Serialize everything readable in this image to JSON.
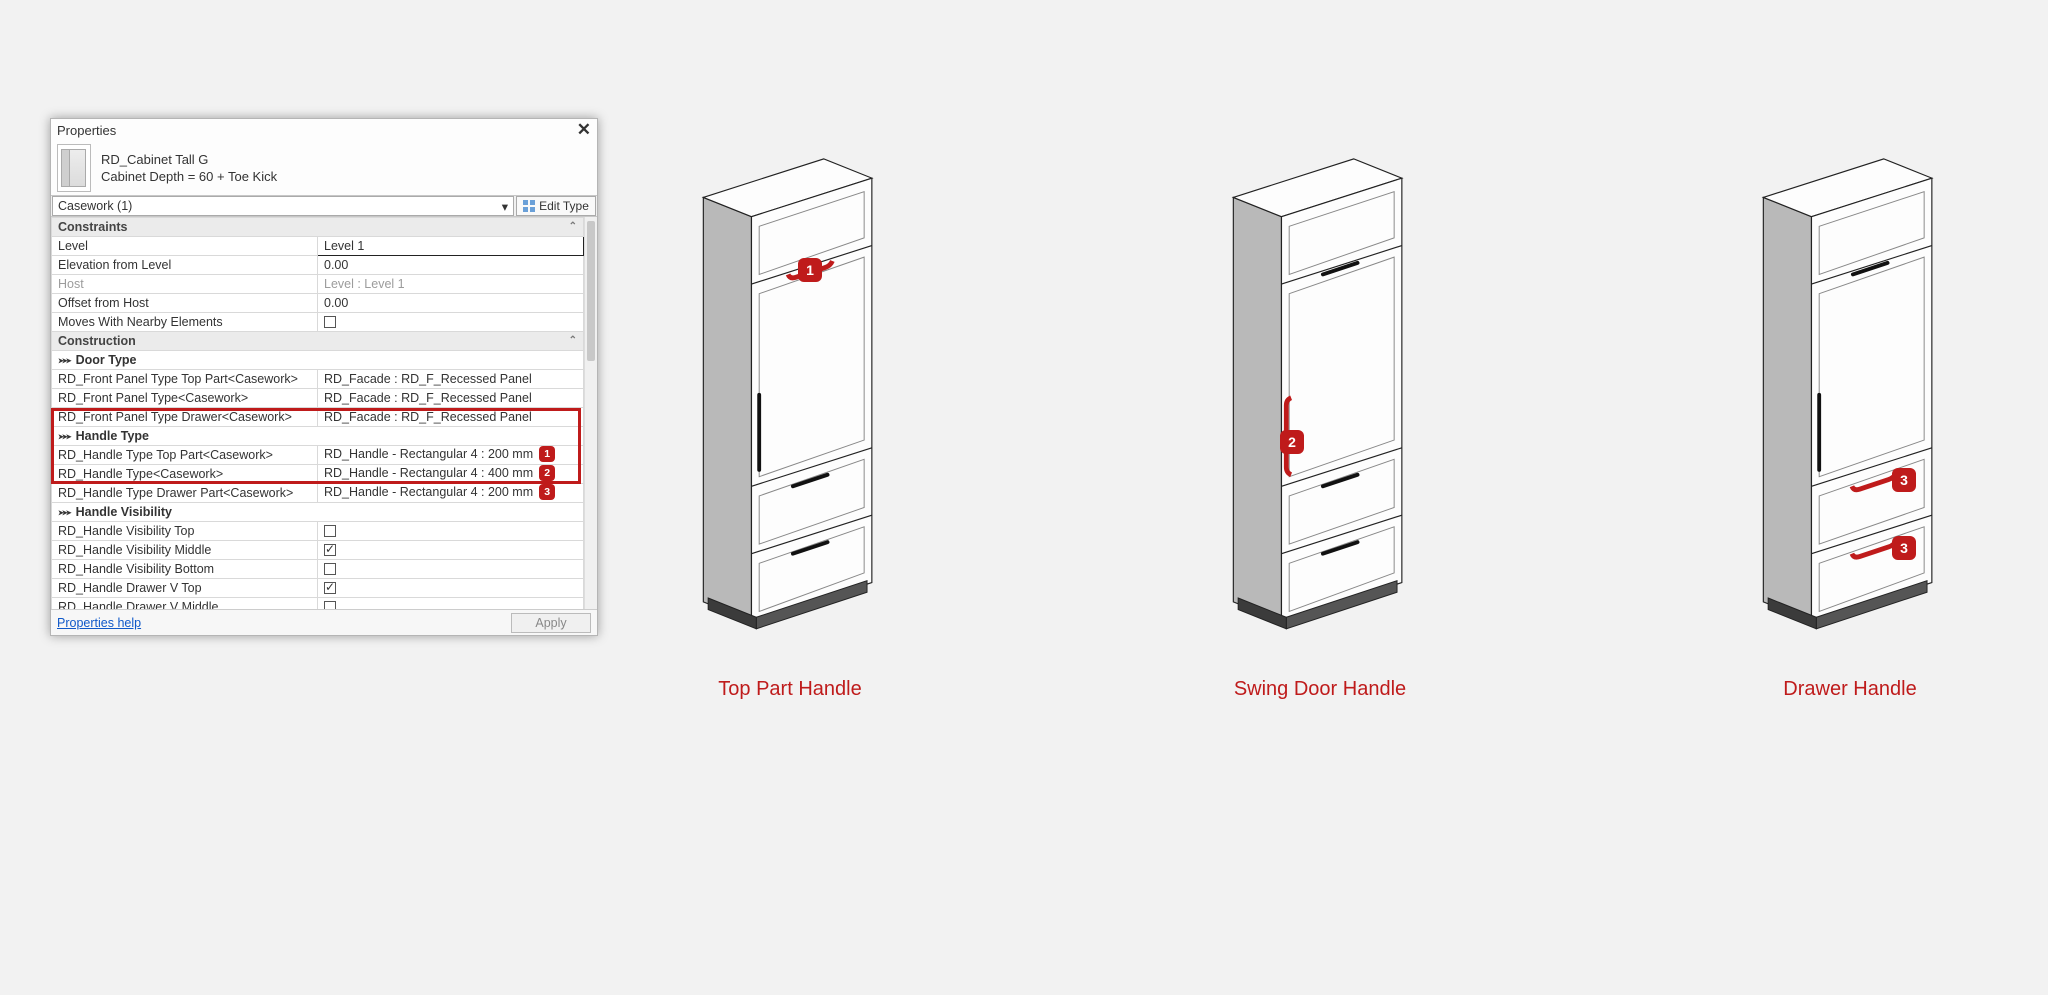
{
  "panel": {
    "title": "Properties",
    "family_name": "RD_Cabinet Tall G",
    "type_name": "Cabinet Depth = 60 + Toe Kick",
    "instance_dd": "Casework (1)",
    "edit_type": "Edit Type",
    "help_link": "Properties help",
    "apply": "Apply"
  },
  "groups": {
    "constraints": "Constraints",
    "construction": "Construction"
  },
  "rows": {
    "level_l": "Level",
    "level_v": "Level 1",
    "elev_l": "Elevation from Level",
    "elev_v": "0.00",
    "host_l": "Host",
    "host_v": "Level : Level 1",
    "offset_l": "Offset from Host",
    "offset_v": "0.00",
    "moves_l": "Moves With Nearby Elements",
    "door_type_hdr": "Door Type",
    "fp_top_l": "RD_Front Panel Type Top Part<Casework>",
    "fp_top_v": "RD_Facade : RD_F_Recessed Panel",
    "fp_mid_l": "RD_Front Panel Type<Casework>",
    "fp_mid_v": "RD_Facade : RD_F_Recessed Panel",
    "fp_drw_l": "RD_Front Panel Type Drawer<Casework>",
    "fp_drw_v": "RD_Facade : RD_F_Recessed Panel",
    "handle_type_hdr": "Handle Type",
    "ht_top_l": "RD_Handle Type Top Part<Casework>",
    "ht_top_v": "RD_Handle - Rectangular 4 : 200 mm",
    "ht_mid_l": "RD_Handle Type<Casework>",
    "ht_mid_v": "RD_Handle - Rectangular 4 : 400 mm",
    "ht_drw_l": "RD_Handle Type Drawer Part<Casework>",
    "ht_drw_v": "RD_Handle - Rectangular 4 : 200 mm",
    "handle_vis_hdr": "Handle Visibility",
    "hv_top_l": "RD_Handle Visibility Top",
    "hv_mid_l": "RD_Handle Visibility Middle",
    "hv_bot_l": "RD_Handle Visibility Bottom",
    "hd_vtop_l": "RD_Handle Drawer V Top",
    "hd_vmid_l": "RD_Handle Drawer V Middle"
  },
  "badges": {
    "b1": "1",
    "b2": "2",
    "b3": "3"
  },
  "captions": {
    "c1": "Top Part Handle",
    "c2": "Swing Door Handle",
    "c3": "Drawer Handle"
  }
}
